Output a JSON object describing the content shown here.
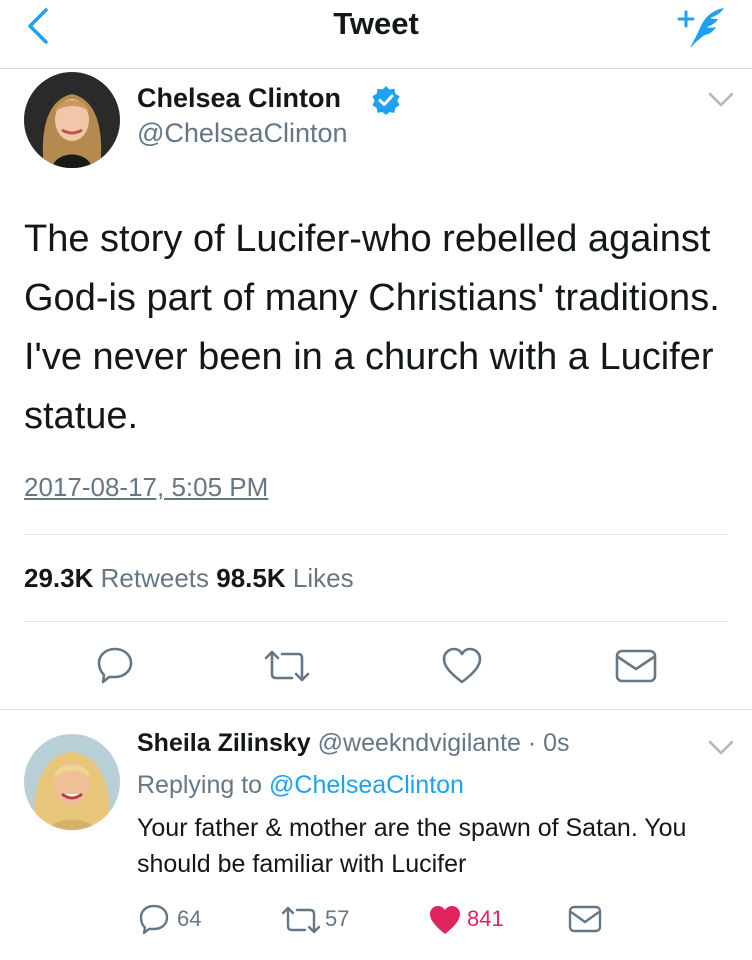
{
  "nav": {
    "title": "Tweet",
    "back_icon": "chevron-left-icon",
    "compose_icon": "compose-tweet-icon"
  },
  "tweet": {
    "author_name": "Chelsea Clinton",
    "handle": "@ChelseaClinton",
    "verified": true,
    "text": "The story of Lucifer-who rebelled against God-is part of many Christians' traditions. I've never been in a church with a Lucifer statue.",
    "timestamp": "2017-08-17, 5:05 PM",
    "retweets_count": "29.3K",
    "retweets_label": "Retweets",
    "likes_count": "98.5K",
    "likes_label": "Likes"
  },
  "reply": {
    "author_name": "Sheila Zilinsky",
    "handle": "@weekndvigilante",
    "time": "· 0s",
    "replying_prefix": "Replying to",
    "replying_to": "@ChelseaClinton",
    "text": "Your father & mother are the spawn of Satan. You should be familiar with Lucifer",
    "replies": "64",
    "retweets": "57",
    "likes": "841"
  },
  "colors": {
    "accent": "#1da1f2",
    "secondary_text": "#657786",
    "like": "#e0245e",
    "divider": "#e1e8ed"
  }
}
